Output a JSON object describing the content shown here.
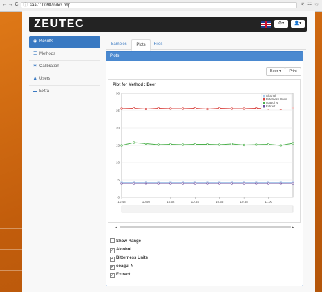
{
  "browser": {
    "url": "saa-110098/index.php",
    "back": "←",
    "forward": "→",
    "reload": "C",
    "info": "ⓘ",
    "right_icons": [
      "₹",
      "☷",
      "☆"
    ]
  },
  "brand": {
    "logo": "ZEUTEC",
    "lang": "English",
    "colors": {
      "accent": "#3979c2",
      "topbar": "#232323"
    }
  },
  "topbar": {
    "settings_label": "⚙▾",
    "user_label": "👤▾"
  },
  "sidebar": {
    "items": [
      {
        "label": "Results",
        "icon": "results-icon",
        "glyph": "◉"
      },
      {
        "label": "Methods",
        "icon": "methods-icon",
        "glyph": "☰"
      },
      {
        "label": "Calibration",
        "icon": "gear-icon",
        "glyph": "✱"
      },
      {
        "label": "Users",
        "icon": "user-icon",
        "glyph": "♟"
      },
      {
        "label": "Extra",
        "icon": "extra-icon",
        "glyph": "▬"
      }
    ]
  },
  "tabs": [
    {
      "label": "Samples"
    },
    {
      "label": "Plots"
    },
    {
      "label": "Files"
    }
  ],
  "panel": {
    "title": "Plots",
    "method_select": "Beer ▾",
    "print_label": "Print",
    "scroll_left": "◂",
    "scroll_right": "▸"
  },
  "chart_data": {
    "type": "line",
    "title": "Plot for Method : Beer",
    "x": [
      "10:48",
      "10:49",
      "10:50",
      "10:51",
      "10:52",
      "10:53",
      "10:54",
      "10:55",
      "10:56",
      "10:57",
      "10:58",
      "10:59",
      "11:00",
      "11:01",
      "11:02"
    ],
    "x_ticks": [
      "10:48",
      "10:50",
      "10:52",
      "10:54",
      "10:56",
      "10:58",
      "11:00"
    ],
    "ylim": [
      0,
      30
    ],
    "y_ticks": [
      0,
      5,
      10,
      15,
      20,
      25,
      30
    ],
    "legend_position": "top-right",
    "series": [
      {
        "name": "Alcohol",
        "color": "#a9c9ea",
        "values": [
          4.3,
          4.3,
          4.3,
          4.3,
          4.3,
          4.3,
          4.3,
          4.3,
          4.3,
          4.3,
          4.3,
          4.3,
          4.3,
          4.3,
          4.3
        ]
      },
      {
        "name": "Bitterness Units",
        "color": "#d9433f",
        "values": [
          25.6,
          25.7,
          25.5,
          25.7,
          25.6,
          25.6,
          25.7,
          25.5,
          25.7,
          25.6,
          25.6,
          25.7,
          25.6,
          25.5,
          25.8
        ]
      },
      {
        "name": "coagul N",
        "color": "#4cb04c",
        "values": [
          15.0,
          15.8,
          15.5,
          15.2,
          15.3,
          15.2,
          15.3,
          15.3,
          15.2,
          15.4,
          15.1,
          15.2,
          15.3,
          15.0,
          15.6
        ]
      },
      {
        "name": "Extract",
        "color": "#6a4a9c",
        "values": [
          4.0,
          4.0,
          4.0,
          4.0,
          4.0,
          4.0,
          4.0,
          4.0,
          4.0,
          4.0,
          4.0,
          4.0,
          4.0,
          4.0,
          4.0
        ]
      }
    ]
  },
  "checkboxes": [
    {
      "label": "Show Range",
      "checked": false
    },
    {
      "label": "Alcohol",
      "checked": true
    },
    {
      "label": "Bitterness Units",
      "checked": true
    },
    {
      "label": "coagul N",
      "checked": true
    },
    {
      "label": "Extract",
      "checked": true
    }
  ]
}
